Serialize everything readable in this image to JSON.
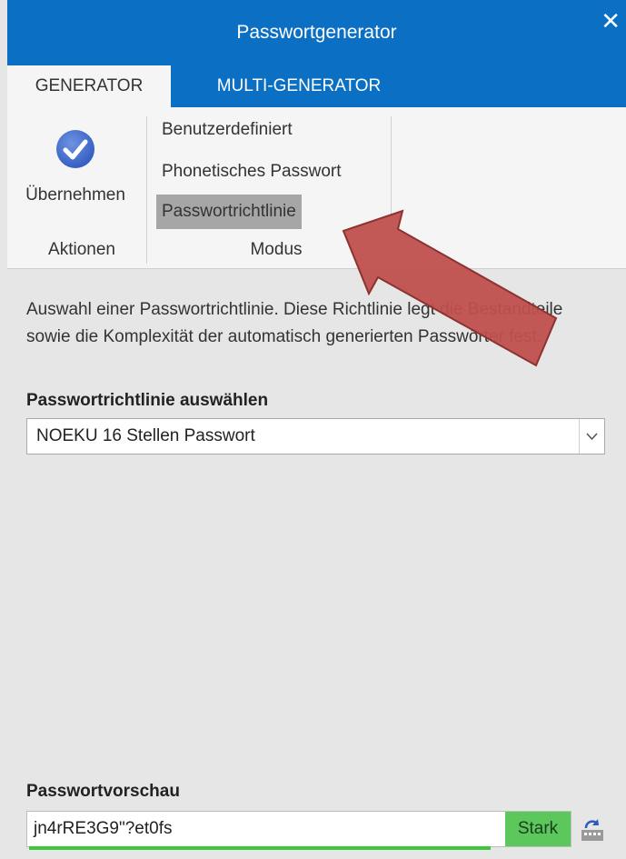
{
  "window": {
    "title": "Passwortgenerator",
    "close_icon": "close-icon"
  },
  "tabs": [
    {
      "label": "GENERATOR",
      "active": true
    },
    {
      "label": "MULTI-GENERATOR",
      "active": false
    }
  ],
  "ribbon": {
    "accept_label": "Übernehmen",
    "accept_icon": "checkmark-circle-icon",
    "actions_group_label": "Aktionen",
    "mode_group_label": "Modus",
    "modes": [
      {
        "label": "Benutzerdefiniert",
        "selected": false
      },
      {
        "label": "Phonetisches Passwort",
        "selected": false
      },
      {
        "label": "Passwortrichtlinie",
        "selected": true
      }
    ]
  },
  "main": {
    "description": "Auswahl einer Passwortrichtlinie. Diese Richtlinie legt die Bestandteile sowie die Komplexität der automatisch generierten Passwörter fest.",
    "policy_label": "Passwortrichtlinie auswählen",
    "policy_selected": "NOEKU 16 Stellen Passwort",
    "preview_label": "Passwortvorschau",
    "preview_value": "jn4rRE3G9\"?et0fs",
    "strength_label": "Stark",
    "strength_level": 0.85,
    "generate_icon": "regenerate-icon"
  },
  "colors": {
    "titlebar": "#0b6fc4",
    "selected_mode": "#a6a6a6",
    "strength": "#5cc85c",
    "annotation_arrow": "#c0504d"
  }
}
